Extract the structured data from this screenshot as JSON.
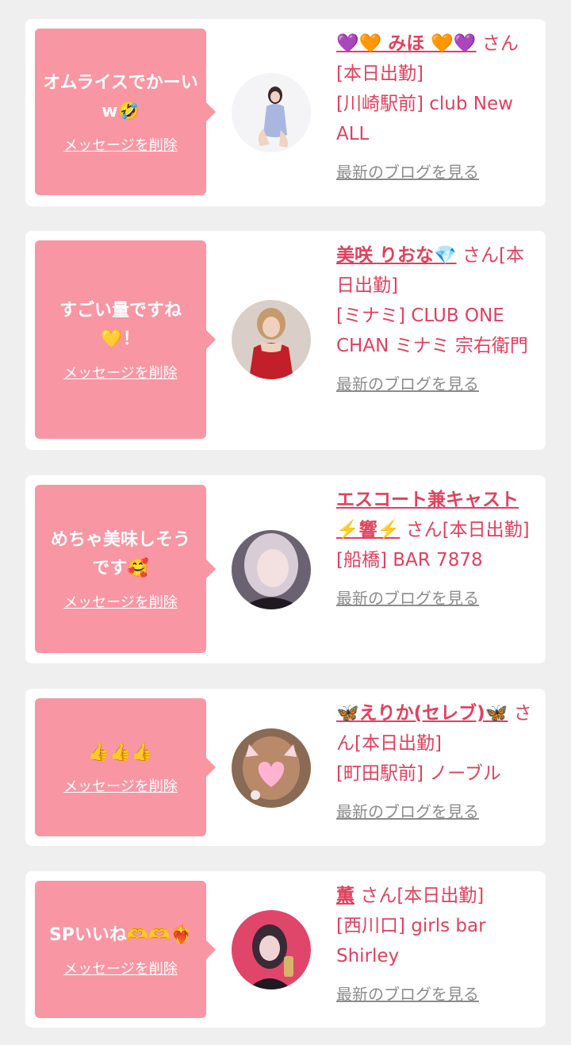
{
  "cards": [
    {
      "message": "オムライスでかーいw🤣",
      "delete_label": "メッセージを削除",
      "cast_name": "💜🧡 みほ 🧡💜",
      "suffix": "さん[本日出勤]",
      "shop": "[川崎駅前] club New ALL",
      "blog_label": "最新のブログを見る"
    },
    {
      "message": "すごい量ですね💛！",
      "delete_label": "メッセージを削除",
      "cast_name": "美咲 りおな💎",
      "suffix": "さん[本日出勤]",
      "shop": "[ミナミ] CLUB ONE CHAN ミナミ 宗右衛門",
      "blog_label": "最新のブログを見る"
    },
    {
      "message": "めちゃ美味しそうです🥰",
      "delete_label": "メッセージを削除",
      "cast_name": "エスコート兼キャスト⚡️響⚡️",
      "suffix": "さん[本日出勤]",
      "shop": "[船橋] BAR 7878",
      "blog_label": "最新のブログを見る"
    },
    {
      "message": "👍👍👍",
      "delete_label": "メッセージを削除",
      "cast_name": "🦋えりか(セレブ)🦋",
      "suffix": "さん[本日出勤]",
      "shop": "[町田駅前] ノーブル",
      "blog_label": "最新のブログを見る"
    },
    {
      "message": "SPいいね🫶🫶❤️‍🔥",
      "delete_label": "メッセージを削除",
      "cast_name": "薫",
      "suffix": "さん[本日出勤]",
      "shop": "[西川口] girls bar Shirley",
      "blog_label": "最新のブログを見る"
    }
  ],
  "colors": {
    "bubble": "#f896a3",
    "accent": "#e0415c",
    "link_gray": "#8c8c8c",
    "background": "#efefef"
  }
}
